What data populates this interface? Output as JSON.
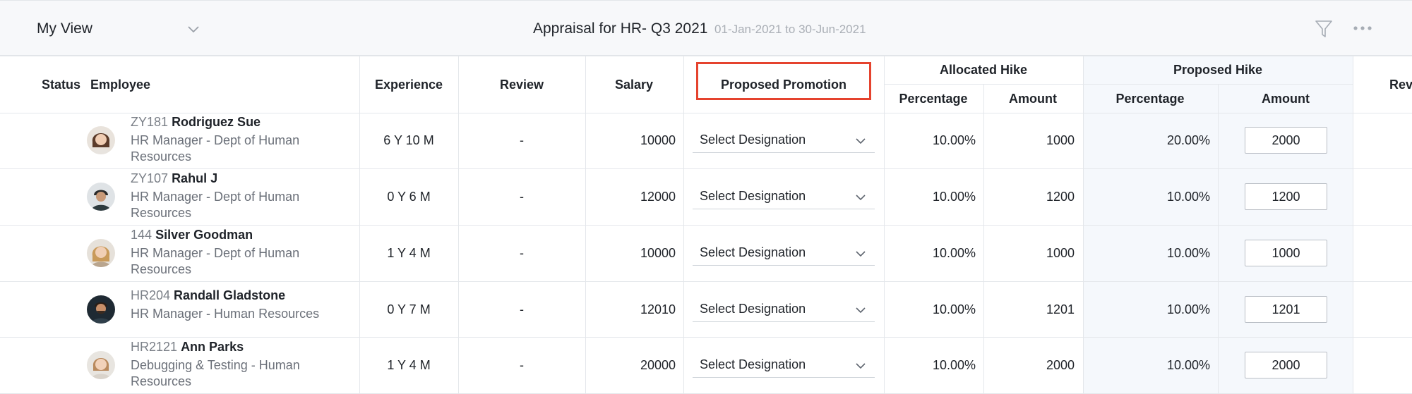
{
  "header": {
    "view_label": "My View",
    "title": "Appraisal for HR- Q3 2021",
    "date_range": "01-Jan-2021 to 30-Jun-2021"
  },
  "table": {
    "columns": {
      "status": "Status",
      "employee": "Employee",
      "experience": "Experience",
      "review": "Review",
      "salary": "Salary",
      "proposed_promotion": "Proposed Promotion",
      "allocated_hike": "Allocated Hike",
      "proposed_hike": "Proposed Hike",
      "percentage": "Percentage",
      "amount": "Amount",
      "next": "Rev"
    },
    "rows": [
      {
        "id": "ZY181",
        "name": "Rodriguez Sue",
        "role": "HR Manager - Dept of Human Resources",
        "experience": "6 Y 10 M",
        "review": "-",
        "salary": "10000",
        "designation": "Select Designation",
        "alloc_pct": "10.00%",
        "alloc_amt": "1000",
        "prop_pct": "20.00%",
        "prop_amt": "2000"
      },
      {
        "id": "ZY107",
        "name": "Rahul J",
        "role": "HR Manager - Dept of Human Resources",
        "experience": "0 Y 6 M",
        "review": "-",
        "salary": "12000",
        "designation": "Select Designation",
        "alloc_pct": "10.00%",
        "alloc_amt": "1200",
        "prop_pct": "10.00%",
        "prop_amt": "1200"
      },
      {
        "id": "144",
        "name": "Silver Goodman",
        "role": "HR Manager - Dept of Human Resources",
        "experience": "1 Y 4 M",
        "review": "-",
        "salary": "10000",
        "designation": "Select Designation",
        "alloc_pct": "10.00%",
        "alloc_amt": "1000",
        "prop_pct": "10.00%",
        "prop_amt": "1000"
      },
      {
        "id": "HR204",
        "name": "Randall Gladstone",
        "role": "HR Manager - Human Resources",
        "experience": "0 Y 7 M",
        "review": "-",
        "salary": "12010",
        "designation": "Select Designation",
        "alloc_pct": "10.00%",
        "alloc_amt": "1201",
        "prop_pct": "10.00%",
        "prop_amt": "1201"
      },
      {
        "id": "HR2121",
        "name": "Ann Parks",
        "role": "Debugging & Testing - Human Resources",
        "experience": "1 Y 4 M",
        "review": "-",
        "salary": "20000",
        "designation": "Select Designation",
        "alloc_pct": "10.00%",
        "alloc_amt": "2000",
        "prop_pct": "10.00%",
        "prop_amt": "2000"
      }
    ]
  },
  "colors": {
    "highlight": "#e5432e",
    "proposed_bg": "#f5f8fc"
  },
  "icons": [
    "chevron-down-icon",
    "filter-icon",
    "more-options-icon"
  ]
}
